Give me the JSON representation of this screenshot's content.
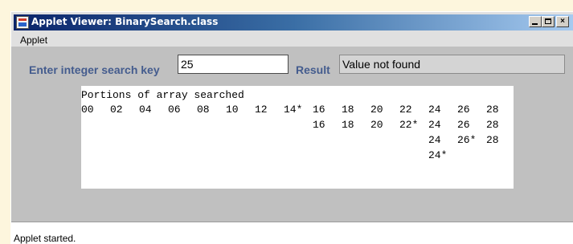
{
  "window": {
    "title": "Applet Viewer: BinarySearch.class",
    "icon": "java-applet-icon",
    "controls": [
      "minimize-icon",
      "maximize-icon",
      "close-icon"
    ],
    "close_glyph": "×"
  },
  "menubar": {
    "items": [
      "Applet"
    ]
  },
  "search": {
    "label": "Enter integer search key",
    "value": "25"
  },
  "result": {
    "label": "Result",
    "value": "Value not found"
  },
  "output": {
    "heading": "Portions of array searched",
    "columns": 15,
    "rows": [
      [
        "00",
        "02",
        "04",
        "06",
        "08",
        "10",
        "12",
        "14*",
        "16",
        "18",
        "20",
        "22",
        "24",
        "26",
        "28"
      ],
      [
        "",
        "",
        "",
        "",
        "",
        "",
        "",
        "",
        "16",
        "18",
        "20",
        "22*",
        "24",
        "26",
        "28"
      ],
      [
        "",
        "",
        "",
        "",
        "",
        "",
        "",
        "",
        "",
        "",
        "",
        "",
        "24",
        "26*",
        "28"
      ],
      [
        "",
        "",
        "",
        "",
        "",
        "",
        "",
        "",
        "",
        "",
        "",
        "",
        "24*",
        "",
        ""
      ]
    ]
  },
  "status": {
    "text": "Applet started."
  },
  "colors": {
    "label_text": "#445c8e",
    "panel_bg": "#c0c0c0",
    "titlebar_start": "#0a246a",
    "titlebar_end": "#a6caf0"
  }
}
